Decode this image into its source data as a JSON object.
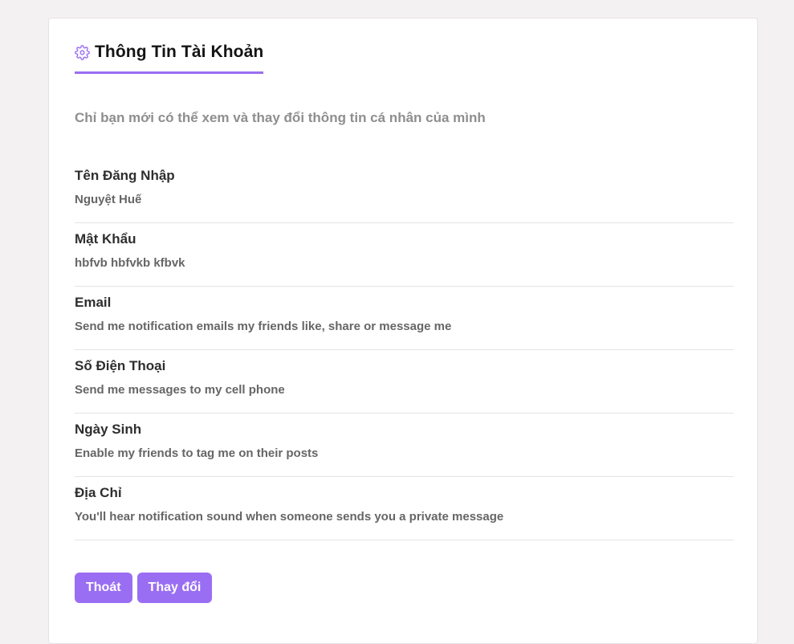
{
  "header": {
    "title": "Thông Tin Tài Khoản",
    "icon": "gear-icon",
    "accent_color": "#9a6ef3"
  },
  "subtitle": "Chỉ bạn mới có thể xem và thay đổi thông tin cá nhân của mình",
  "fields": [
    {
      "label": "Tên Đăng Nhập",
      "value": "Nguyệt Huế"
    },
    {
      "label": "Mật Khẩu",
      "value": "hbfvb hbfvkb kfbvk"
    },
    {
      "label": "Email",
      "value": "Send me notification emails my friends like, share or message me"
    },
    {
      "label": "Số Điện Thoại",
      "value": "Send me messages to my cell phone"
    },
    {
      "label": "Ngày Sinh",
      "value": "Enable my friends to tag me on their posts"
    },
    {
      "label": "Địa Chỉ",
      "value": "You'll hear notification sound when someone sends you a private message"
    }
  ],
  "buttons": {
    "exit_label": "Thoát",
    "change_label": "Thay đổi"
  }
}
